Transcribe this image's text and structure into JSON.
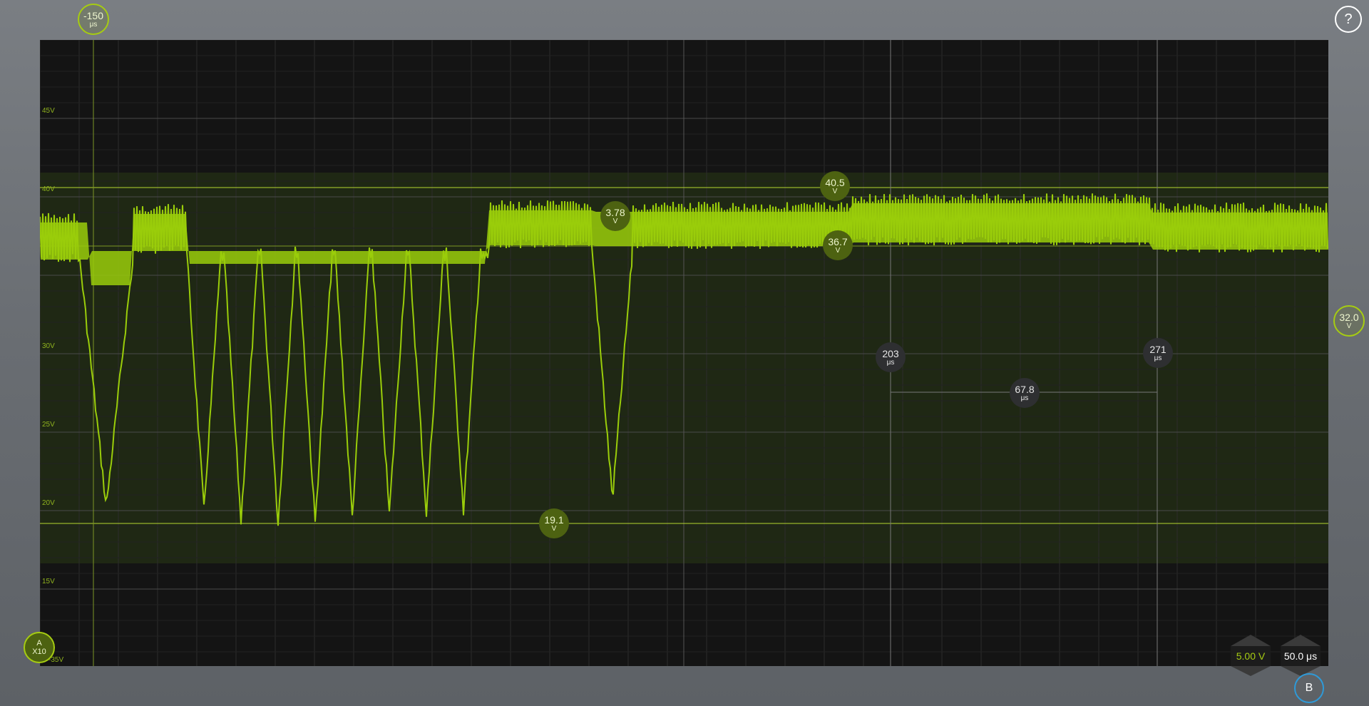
{
  "app": {
    "help_label": "?",
    "channel_b_label": "B"
  },
  "colors": {
    "trace": "#9acd0a",
    "plot_bg": "#141414",
    "grid": "#2c2c2c",
    "grid_major": "#4a4a4a",
    "level_line": "#b6d630",
    "channel_b": "#2e9ad8"
  },
  "y_axis": {
    "labels": [
      "45V",
      "40V",
      "30V",
      "25V",
      "20V",
      "15V",
      "-35V"
    ]
  },
  "channel_a": {
    "name": "A",
    "probe": "X10"
  },
  "trigger_time": {
    "value": "-150",
    "unit": "μs"
  },
  "trigger_level": {
    "value": "32.0",
    "unit": "V"
  },
  "cursors": {
    "level_high": {
      "value": "40.5",
      "unit": "V"
    },
    "level_mid": {
      "value": "36.7",
      "unit": "V"
    },
    "level_delta": {
      "value": "3.78",
      "unit": "V"
    },
    "level_low": {
      "value": "19.1",
      "unit": "V"
    },
    "time_a": {
      "value": "203",
      "unit": "μs"
    },
    "time_b": {
      "value": "271",
      "unit": "μs"
    },
    "time_delta": {
      "value": "67.8",
      "unit": "μs"
    }
  },
  "scale": {
    "volts_per_div": "5.00 V",
    "time_per_div": "50.0 μs"
  }
}
